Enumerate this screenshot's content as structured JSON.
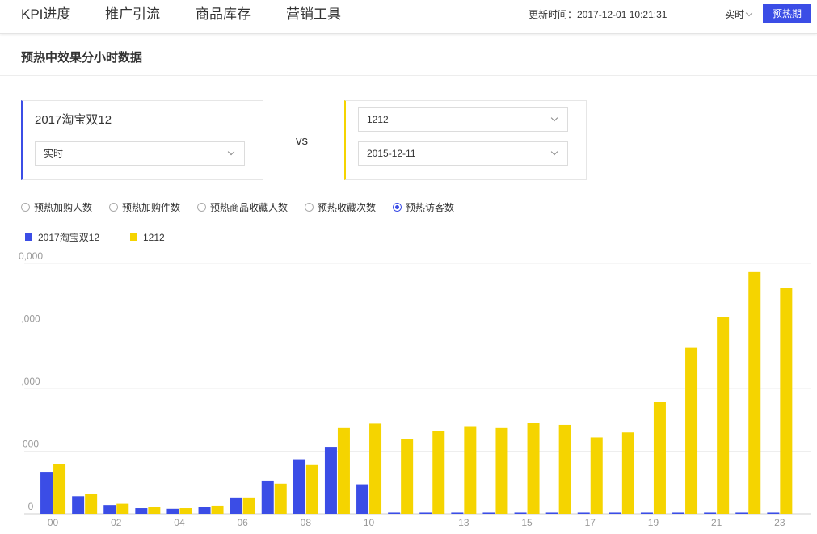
{
  "nav": {
    "tabs": [
      {
        "label": "KPI进度",
        "active": true
      },
      {
        "label": "推广引流",
        "active": false
      },
      {
        "label": "商品库存",
        "active": false
      },
      {
        "label": "营销工具",
        "active": false
      }
    ],
    "updated_label": "更新时间：2017-12-01 10:21:31",
    "mode_select": "实时",
    "preheat_button": "预热期"
  },
  "section": {
    "title": "预热中效果分小时数据"
  },
  "compare": {
    "left": {
      "title": "2017淘宝双12",
      "select_value": "实时"
    },
    "vs_label": "vs",
    "right": {
      "event_select": "1212",
      "date_select": "2015-12-11"
    }
  },
  "metrics": [
    {
      "label": "预热加购人数",
      "checked": false
    },
    {
      "label": "预热加购件数",
      "checked": false
    },
    {
      "label": "预热商品收藏人数",
      "checked": false
    },
    {
      "label": "预热收藏次数",
      "checked": false
    },
    {
      "label": "预热访客数",
      "checked": true
    }
  ],
  "colors": {
    "accent": "#3b4de6",
    "series_a": "#3b4de6",
    "series_b": "#f5d400"
  },
  "chart_data": {
    "type": "bar",
    "legend": "top-left",
    "grid": true,
    "x": [
      "00",
      "01",
      "02",
      "03",
      "04",
      "05",
      "06",
      "07",
      "08",
      "09",
      "10",
      "11",
      "12",
      "13",
      "14",
      "15",
      "16",
      "17",
      "18",
      "19",
      "20",
      "21",
      "22",
      "23"
    ],
    "x_tick_labels": [
      "00",
      "02",
      "04",
      "06",
      "08",
      "10",
      "13",
      "15",
      "17",
      "19",
      "21",
      "23"
    ],
    "y_tick_labels": [
      "0",
      "000",
      ",000",
      ",000",
      "0,000"
    ],
    "ylim": [
      0,
      40
    ],
    "series": [
      {
        "name": "2017淘宝双12",
        "values": [
          6.7,
          2.8,
          1.4,
          0.9,
          0.8,
          1.1,
          2.6,
          5.3,
          8.7,
          10.7,
          4.7,
          0.2,
          0.2,
          0.2,
          0.2,
          0.2,
          0.2,
          0.2,
          0.2,
          0.2,
          0.2,
          0.2,
          0.2,
          0.2
        ]
      },
      {
        "name": "1212",
        "values": [
          8.0,
          3.2,
          1.6,
          1.1,
          0.9,
          1.3,
          2.6,
          4.8,
          7.9,
          13.7,
          14.4,
          12.0,
          13.2,
          14.0,
          13.7,
          14.5,
          14.2,
          12.2,
          13.0,
          17.9,
          26.5,
          31.4,
          38.6,
          36.1
        ]
      }
    ]
  }
}
